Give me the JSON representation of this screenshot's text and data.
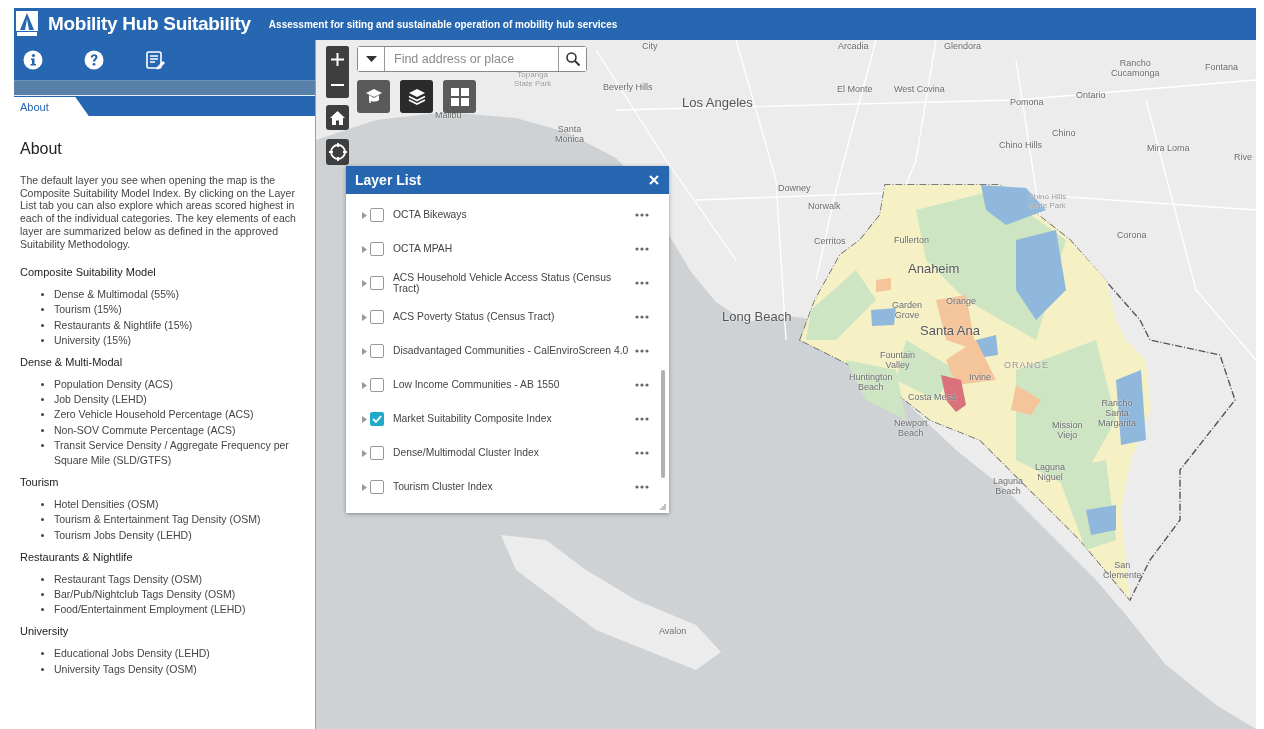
{
  "header": {
    "title": "Mobility Hub Suitability",
    "subtitle": "Assessment for siting and sustainable operation of mobility hub services"
  },
  "sidebar_tools": [
    {
      "kind": "info"
    },
    {
      "kind": "help"
    },
    {
      "kind": "notes"
    }
  ],
  "tabs": [
    {
      "label": "About",
      "selected": true
    }
  ],
  "about": {
    "heading": "About",
    "intro": "The default layer you see when opening the map is the Composite Suitability Model Index. By clicking on the Layer List tab you can also explore which areas scored highest in each of the individual categories. The key elements of each layer are summarized below as defined in the approved Suitability Methodology.",
    "sections": [
      {
        "title": "Composite Suitability Model",
        "items": [
          "Dense & Multimodal (55%)",
          "Tourism (15%)",
          "Restaurants & Nightlife (15%)",
          "University (15%)"
        ]
      },
      {
        "title": "Dense & Multi-Modal",
        "items": [
          "Population Density (ACS)",
          "Job Density (LEHD)",
          "Zero Vehicle Household Percentage (ACS)",
          "Non-SOV Commute Percentage (ACS)",
          "Transit Service Density / Aggregate Frequency per Square Mile (SLD/GTFS)"
        ]
      },
      {
        "title": "Tourism",
        "items": [
          "Hotel Densities (OSM)",
          "Tourism & Entertainment Tag Density (OSM)",
          "Tourism Jobs Density (LEHD)"
        ]
      },
      {
        "title": "Restaurants & Nightlife",
        "items": [
          "Restaurant Tags Density (OSM)",
          "Bar/Pub/Nightclub Tags Density (OSM)",
          "Food/Entertainment Employment (LEHD)"
        ]
      },
      {
        "title": "University",
        "items": [
          "Educational Jobs Density (LEHD)",
          "University Tags Density (OSM)"
        ]
      }
    ]
  },
  "map": {
    "search": {
      "placeholder": "Find address or place"
    },
    "widgets": [
      {
        "kind": "mortarboard",
        "selected": false
      },
      {
        "kind": "layers",
        "selected": true
      },
      {
        "kind": "grid",
        "selected": false
      }
    ],
    "labels": [
      {
        "text": "City",
        "kind": "city"
      },
      {
        "text": "Arcadia",
        "kind": "city"
      },
      {
        "text": "Glendora",
        "kind": "city"
      },
      {
        "text": "Topanga\nState Park",
        "kind": "park"
      },
      {
        "text": "Beverly Hills",
        "kind": "city"
      },
      {
        "text": "Los Angeles",
        "kind": "major"
      },
      {
        "text": "El Monte",
        "kind": "city"
      },
      {
        "text": "West Covina",
        "kind": "city"
      },
      {
        "text": "Rancho\nCucamonga",
        "kind": "city"
      },
      {
        "text": "Fontana",
        "kind": "city"
      },
      {
        "text": "Ontario",
        "kind": "city"
      },
      {
        "text": "Pomona",
        "kind": "city"
      },
      {
        "text": "Malibu",
        "kind": "city"
      },
      {
        "text": "Santa\nMonica",
        "kind": "city"
      },
      {
        "text": "Chino",
        "kind": "city"
      },
      {
        "text": "Chino Hills",
        "kind": "city"
      },
      {
        "text": "Mira Loma",
        "kind": "city"
      },
      {
        "text": "Rive",
        "kind": "city"
      },
      {
        "text": "Downey",
        "kind": "city"
      },
      {
        "text": "Norwalk",
        "kind": "city"
      },
      {
        "text": "Cerritos",
        "kind": "city"
      },
      {
        "text": "Chino Hills\nState Park",
        "kind": "park"
      },
      {
        "text": "Fullerton",
        "kind": "city"
      },
      {
        "text": "Corona",
        "kind": "city"
      },
      {
        "text": "Anaheim",
        "kind": "major"
      },
      {
        "text": "Garden\nGrove",
        "kind": "city"
      },
      {
        "text": "Orange",
        "kind": "city"
      },
      {
        "text": "Long Beach",
        "kind": "major"
      },
      {
        "text": "Santa Ana",
        "kind": "major"
      },
      {
        "text": "Fountain\nValley",
        "kind": "city"
      },
      {
        "text": "ORANGE",
        "kind": "region"
      },
      {
        "text": "Irvine",
        "kind": "city"
      },
      {
        "text": "Huntington\nBeach",
        "kind": "city"
      },
      {
        "text": "Costa Mesa",
        "kind": "city"
      },
      {
        "text": "Newport\nBeach",
        "kind": "city"
      },
      {
        "text": "Rancho\nSanta\nMargarita",
        "kind": "city"
      },
      {
        "text": "Mission\nViejo",
        "kind": "city"
      },
      {
        "text": "Laguna\nNiguel",
        "kind": "city"
      },
      {
        "text": "Laguna\nBeach",
        "kind": "city"
      },
      {
        "text": "San\nClemente",
        "kind": "city"
      },
      {
        "text": "Avalon",
        "kind": "city"
      }
    ],
    "layer_list": {
      "title": "Layer List",
      "layers": [
        {
          "name": "OCTA Bikeways",
          "checked": false
        },
        {
          "name": "OCTA MPAH",
          "checked": false
        },
        {
          "name": "ACS Household Vehicle Access Status (Census Tract)",
          "checked": false
        },
        {
          "name": "ACS Poverty Status (Census Tract)",
          "checked": false
        },
        {
          "name": "Disadvantaged Communities - CalEnviroScreen 4.0",
          "checked": false
        },
        {
          "name": "Low Income Communities - AB 1550",
          "checked": false
        },
        {
          "name": "Market Suitability Composite Index",
          "checked": true
        },
        {
          "name": "Dense/Multimodal Cluster Index",
          "checked": false
        },
        {
          "name": "Tourism Cluster Index",
          "checked": false
        }
      ]
    }
  }
}
